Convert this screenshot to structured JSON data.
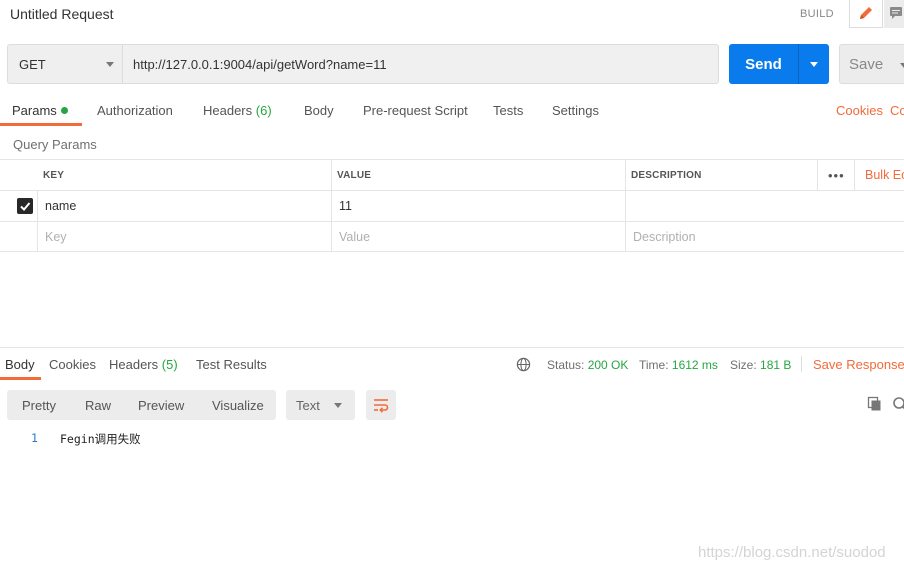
{
  "header": {
    "title": "Untitled Request",
    "build_label": "BUILD"
  },
  "request": {
    "method": "GET",
    "url": "http://127.0.0.1:9004/api/getWord?name=11",
    "send_label": "Send",
    "save_label": "Save"
  },
  "request_tabs": {
    "params": "Params",
    "authorization": "Authorization",
    "headers": "Headers",
    "headers_count": "(6)",
    "body": "Body",
    "pre_request": "Pre-request Script",
    "tests": "Tests",
    "settings": "Settings",
    "cookies": "Cookies",
    "code": "Co"
  },
  "query_params": {
    "title": "Query Params",
    "columns": {
      "key": "KEY",
      "value": "VALUE",
      "description": "DESCRIPTION"
    },
    "bulk_edit": "Bulk Ec",
    "rows": [
      {
        "checked": true,
        "key": "name",
        "value": "11",
        "description": ""
      }
    ],
    "placeholders": {
      "key": "Key",
      "value": "Value",
      "description": "Description"
    }
  },
  "response": {
    "tabs": {
      "body": "Body",
      "cookies": "Cookies",
      "headers": "Headers",
      "headers_count": "(5)",
      "test_results": "Test Results"
    },
    "status_label": "Status:",
    "status_value": "200 OK",
    "time_label": "Time:",
    "time_value": "1612 ms",
    "size_label": "Size:",
    "size_value": "181 B",
    "save_response": "Save Response",
    "view_modes": [
      "Pretty",
      "Raw",
      "Preview",
      "Visualize"
    ],
    "format": "Text",
    "lines": [
      {
        "number": "1",
        "text": "Fegin调用失败"
      }
    ]
  },
  "watermark": "https://blog.csdn.net/suodod",
  "colors": {
    "accent": "#f26b3a",
    "send": "#097bed",
    "success": "#26a642"
  },
  "icons": [
    "edit-icon",
    "comment-icon",
    "globe-icon",
    "wrap-lines-icon",
    "copy-icon",
    "search-icon",
    "checkmark-icon"
  ]
}
